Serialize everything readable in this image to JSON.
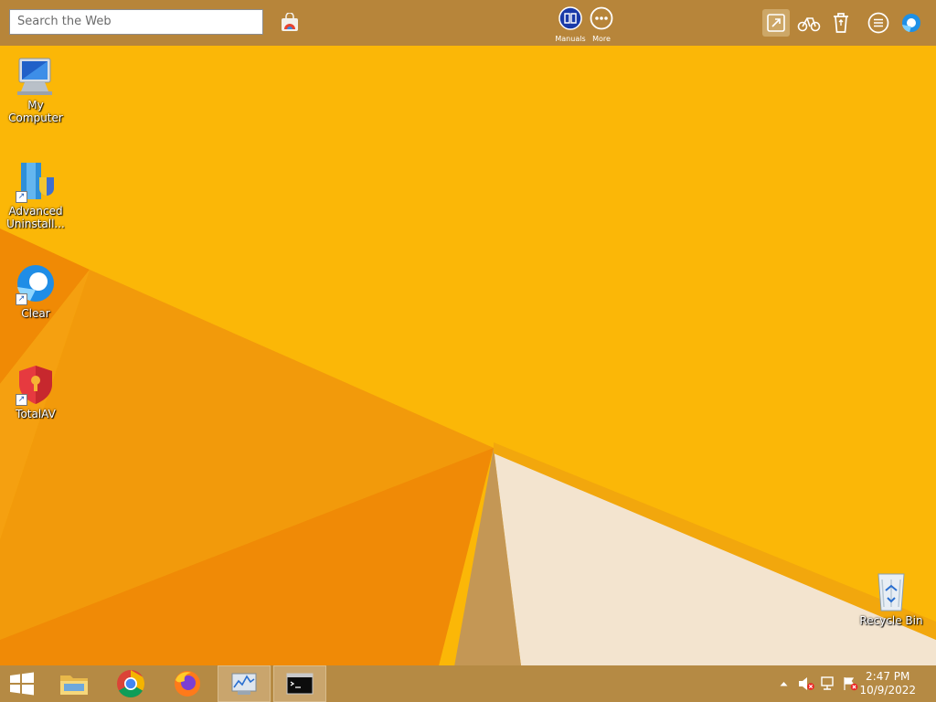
{
  "toolbar": {
    "search_placeholder": "Search the Web",
    "manuals_label": "Manuals",
    "more_label": "More"
  },
  "desktop": {
    "icons": [
      {
        "label": "My Computer"
      },
      {
        "label": "Advanced Uninstall..."
      },
      {
        "label": "Clear"
      },
      {
        "label": "TotalAV"
      },
      {
        "label": "Recycle Bin"
      }
    ]
  },
  "taskbar": {
    "clock_time": "2:47 PM",
    "clock_date": "10/9/2022"
  },
  "colors": {
    "wallpaper": "#f9b004",
    "toolbar": "#b7853a",
    "taskbar": "#b58a44"
  }
}
